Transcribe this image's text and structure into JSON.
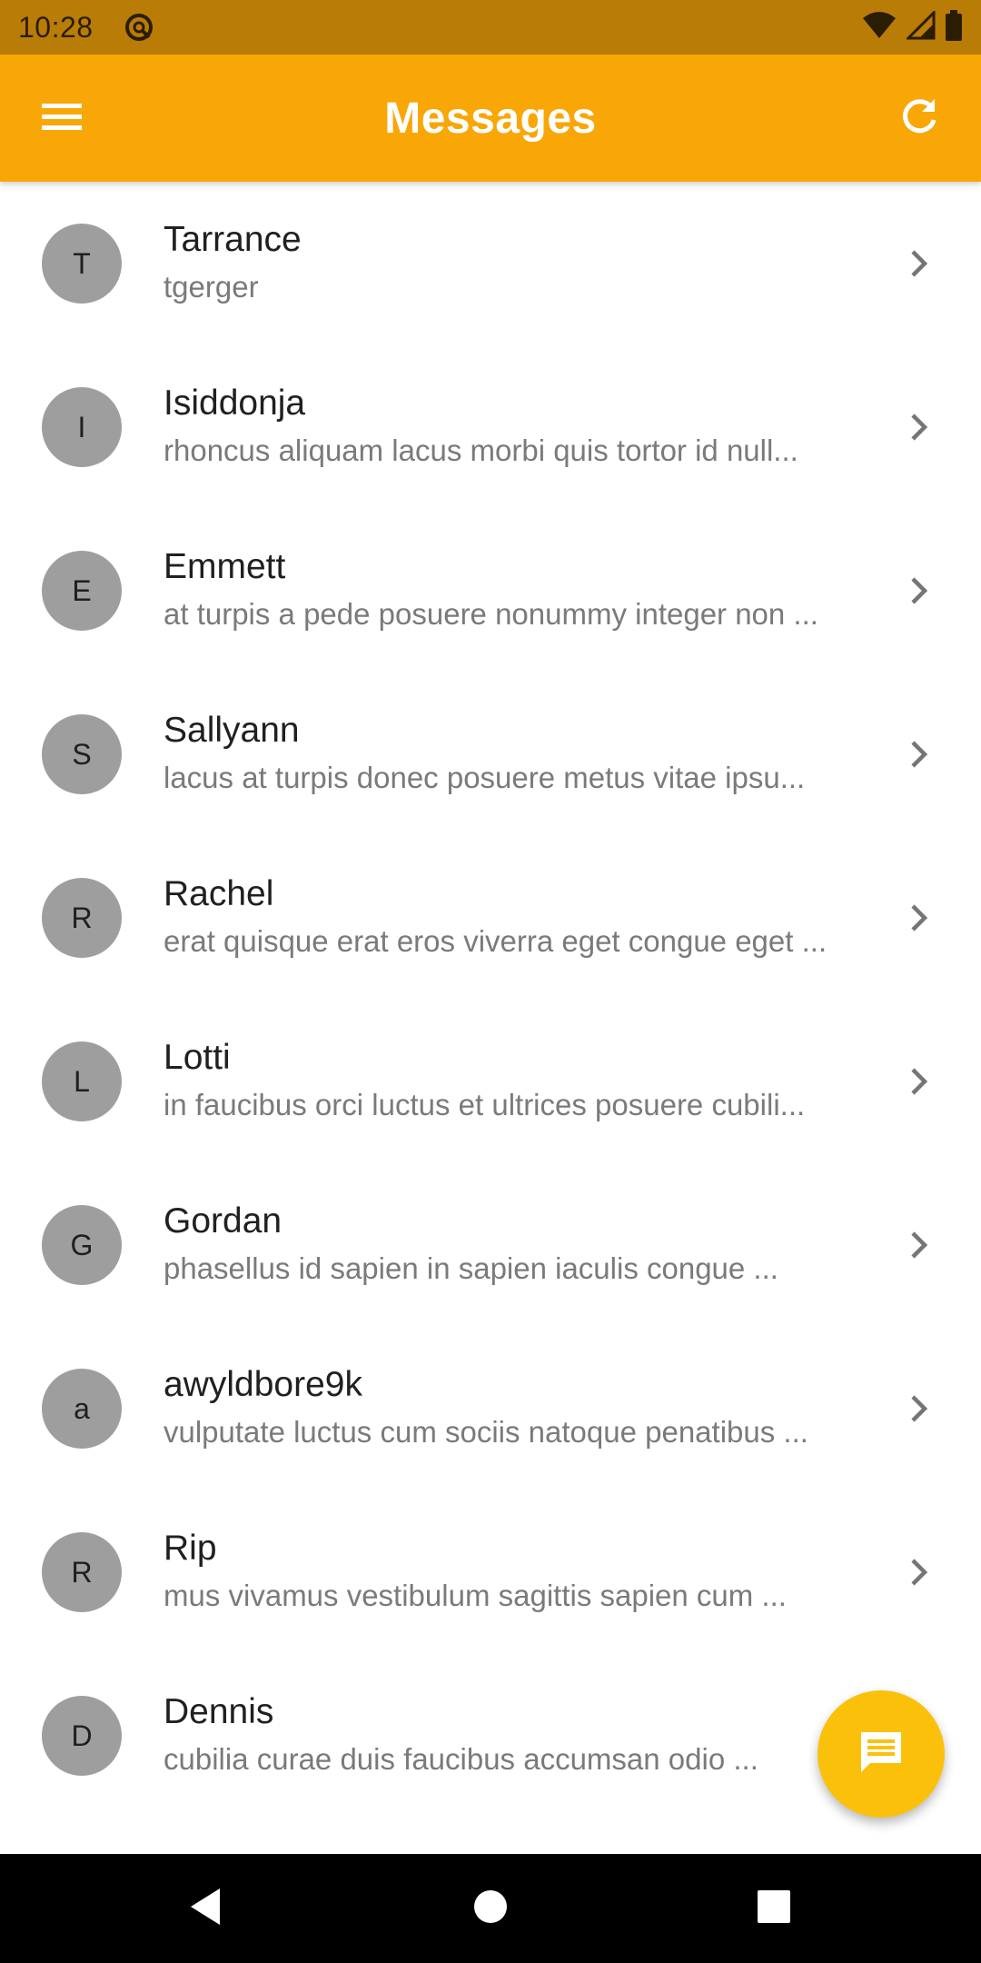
{
  "status_bar": {
    "time": "10:28"
  },
  "app_bar": {
    "title": "Messages",
    "menu_icon": "hamburger-menu-icon",
    "refresh_icon": "refresh-icon"
  },
  "messages": [
    {
      "initial": "T",
      "name": "Tarrance",
      "preview": "tgerger"
    },
    {
      "initial": "I",
      "name": "Isiddonja",
      "preview": "rhoncus aliquam lacus morbi quis tortor id null..."
    },
    {
      "initial": "E",
      "name": "Emmett",
      "preview": "at turpis a pede posuere nonummy integer non ..."
    },
    {
      "initial": "S",
      "name": "Sallyann",
      "preview": "lacus at turpis donec posuere metus vitae ipsu..."
    },
    {
      "initial": "R",
      "name": "Rachel",
      "preview": "erat quisque erat eros viverra eget congue eget ..."
    },
    {
      "initial": "L",
      "name": "Lotti",
      "preview": "in faucibus orci luctus et ultrices posuere cubili..."
    },
    {
      "initial": "G",
      "name": "Gordan",
      "preview": "phasellus id sapien in sapien iaculis congue ..."
    },
    {
      "initial": "a",
      "name": "awyldbore9k",
      "preview": "vulputate luctus cum sociis natoque penatibus ..."
    },
    {
      "initial": "R",
      "name": "Rip",
      "preview": "mus vivamus vestibulum sagittis sapien cum ..."
    },
    {
      "initial": "D",
      "name": "Dennis",
      "preview": "cubilia curae duis faucibus accumsan odio ..."
    }
  ],
  "fab": {
    "icon": "message-icon"
  },
  "colors": {
    "status_bar": "#b97c07",
    "app_bar": "#f9a607",
    "fab": "#fbc10a",
    "avatar": "#9e9e9e"
  }
}
